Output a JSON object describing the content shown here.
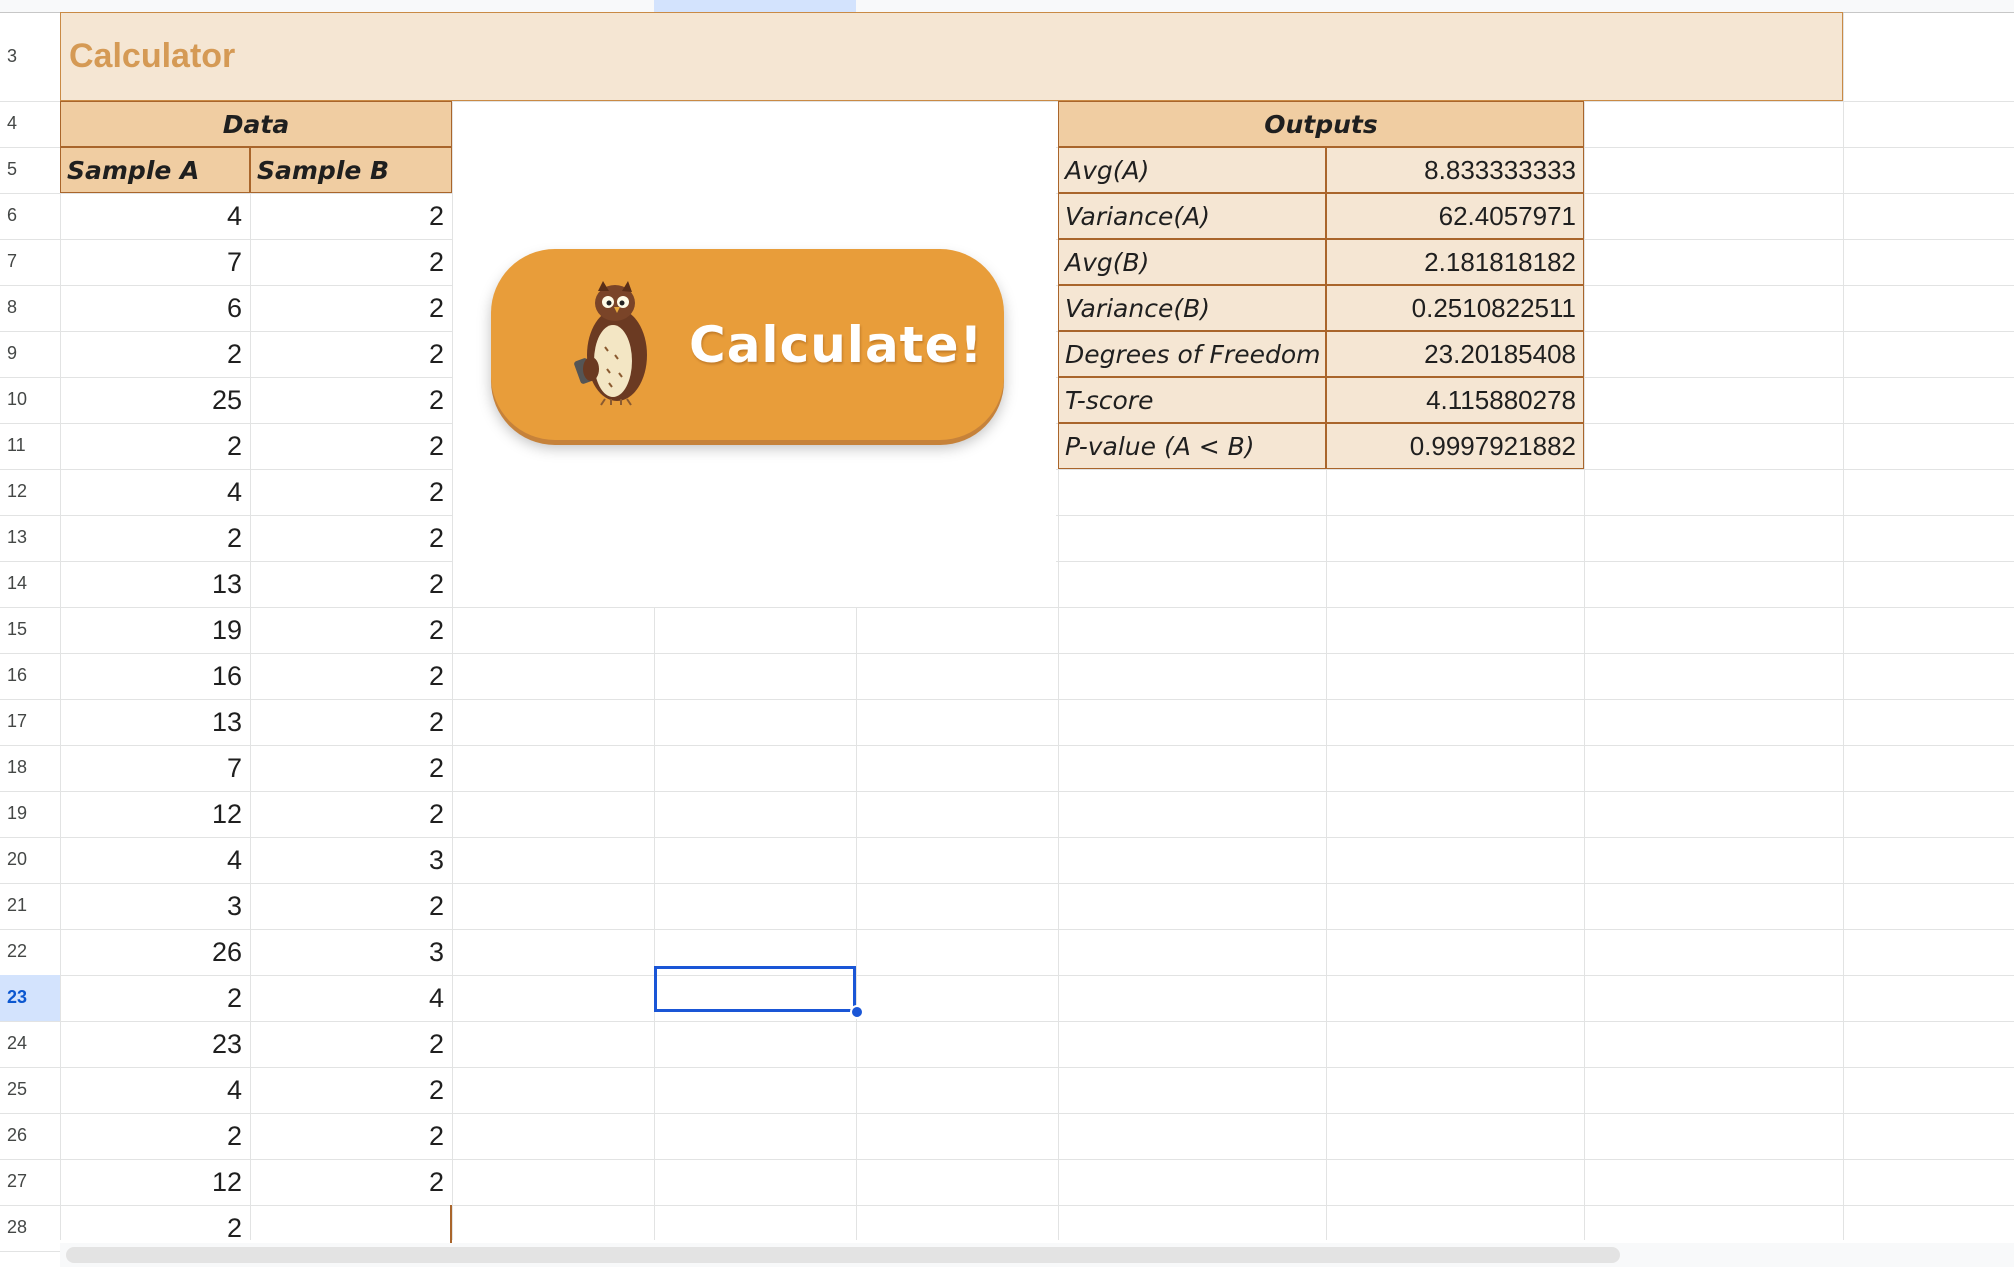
{
  "rows": [
    "3",
    "4",
    "5",
    "6",
    "7",
    "8",
    "9",
    "10",
    "11",
    "12",
    "13",
    "14",
    "15",
    "16",
    "17",
    "18",
    "19",
    "20",
    "21",
    "22",
    "23",
    "24",
    "25",
    "26",
    "27",
    "28"
  ],
  "selected_row": "23",
  "title": "Calculator",
  "data_header": "Data",
  "col_a_header": "Sample A",
  "col_b_header": "Sample B",
  "sample_a": [
    "4",
    "7",
    "6",
    "2",
    "25",
    "2",
    "4",
    "2",
    "13",
    "19",
    "16",
    "13",
    "7",
    "12",
    "4",
    "3",
    "26",
    "2",
    "23",
    "4",
    "2",
    "12",
    "2"
  ],
  "sample_b": [
    "2",
    "2",
    "2",
    "2",
    "2",
    "2",
    "2",
    "2",
    "2",
    "2",
    "2",
    "2",
    "2",
    "2",
    "3",
    "2",
    "3",
    "4",
    "2",
    "2",
    "2",
    "2",
    ""
  ],
  "outputs_header": "Outputs",
  "outputs": [
    {
      "label": "Avg(A)",
      "value": "8.833333333"
    },
    {
      "label": "Variance(A)",
      "value": "62.4057971"
    },
    {
      "label": "Avg(B)",
      "value": "2.181818182"
    },
    {
      "label": "Variance(B)",
      "value": "0.2510822511"
    },
    {
      "label": "Degrees of Freedom",
      "value": "23.20185408"
    },
    {
      "label": "T-score",
      "value": "4.115880278"
    },
    {
      "label": "P-value (A < B)",
      "value": "0.9997921882"
    }
  ],
  "button_label": "Calculate!",
  "button_icon": "owl-icon",
  "colors": {
    "accent": "#e89d3a",
    "title": "#d59a55",
    "header_fill": "#f0cda2",
    "cell_fill": "#f5e6d3",
    "border": "#a9652b",
    "selection": "#1a56d6"
  }
}
